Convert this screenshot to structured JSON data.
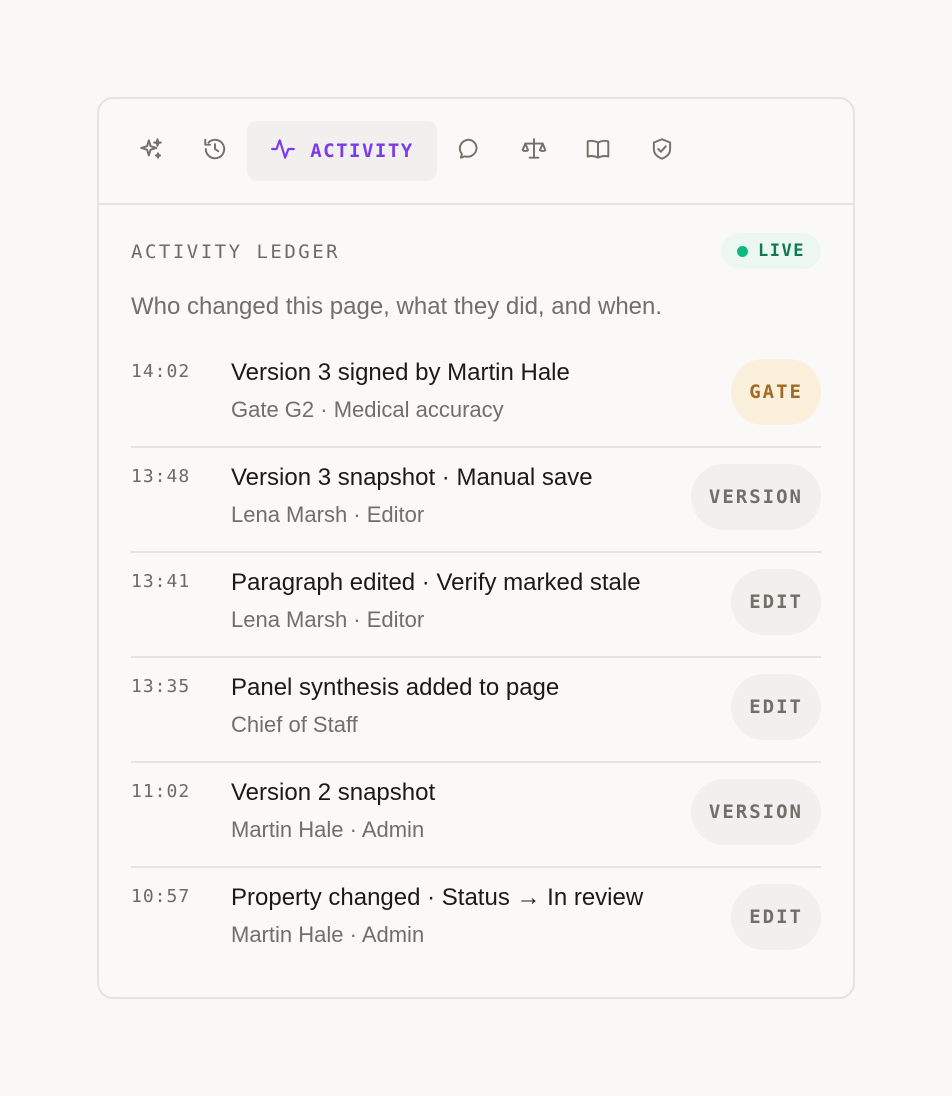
{
  "toolbar": {
    "tools": [
      {
        "icon": "sparkles-icon"
      },
      {
        "icon": "history-icon"
      },
      {
        "icon": "activity-icon",
        "label": "ACTIVITY",
        "active": true
      },
      {
        "icon": "comment-icon"
      },
      {
        "icon": "scale-icon"
      },
      {
        "icon": "book-icon"
      },
      {
        "icon": "shield-check-icon"
      }
    ],
    "active_color": "#7c3aed"
  },
  "ledger": {
    "title": "ACTIVITY LEDGER",
    "live_label": "LIVE",
    "live_color": "#10b981",
    "subtitle": "Who changed this page, what they did, and when."
  },
  "entries": [
    {
      "time": "14:02",
      "title": "Version 3 signed by Martin Hale",
      "sub": "Gate G2 · Medical accuracy",
      "tag": "GATE"
    },
    {
      "time": "13:48",
      "title": "Version 3 snapshot · Manual save",
      "sub": "Lena Marsh · Editor",
      "tag": "VERSION"
    },
    {
      "time": "13:41",
      "title": "Paragraph edited · Verify marked stale",
      "sub": "Lena Marsh · Editor",
      "tag": "EDIT"
    },
    {
      "time": "13:35",
      "title": "Panel synthesis added to page",
      "sub": "Chief of Staff",
      "tag": "EDIT"
    },
    {
      "time": "11:02",
      "title": "Version 2 snapshot",
      "sub": "Martin Hale · Admin",
      "tag": "VERSION"
    },
    {
      "time": "10:57",
      "title": "Property changed · Status → In review",
      "sub": "Martin Hale · Admin",
      "tag": "EDIT"
    }
  ]
}
